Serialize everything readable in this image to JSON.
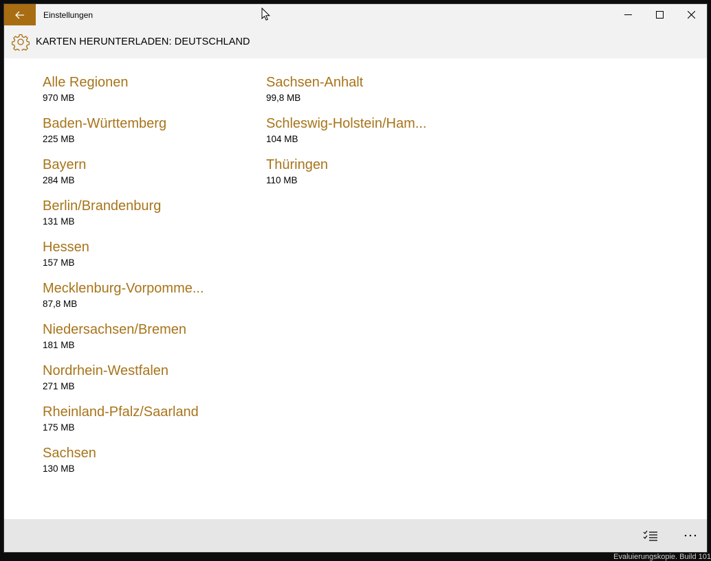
{
  "window": {
    "title": "Einstellungen"
  },
  "header": {
    "title": "KARTEN HERUNTERLADEN: DEUTSCHLAND"
  },
  "regions_col1": [
    {
      "name": "Alle Regionen",
      "size": "970 MB"
    },
    {
      "name": "Baden-Württemberg",
      "size": "225 MB"
    },
    {
      "name": "Bayern",
      "size": "284 MB"
    },
    {
      "name": "Berlin/Brandenburg",
      "size": "131 MB"
    },
    {
      "name": "Hessen",
      "size": "157 MB"
    },
    {
      "name": "Mecklenburg-Vorpomme...",
      "size": "87,8 MB"
    },
    {
      "name": "Niedersachsen/Bremen",
      "size": "181 MB"
    },
    {
      "name": "Nordrhein-Westfalen",
      "size": "271 MB"
    },
    {
      "name": "Rheinland-Pfalz/Saarland",
      "size": "175 MB"
    },
    {
      "name": "Sachsen",
      "size": "130 MB"
    }
  ],
  "regions_col2": [
    {
      "name": "Sachsen-Anhalt",
      "size": "99,8 MB"
    },
    {
      "name": "Schleswig-Holstein/Ham...",
      "size": "104 MB"
    },
    {
      "name": "Thüringen",
      "size": "110 MB"
    }
  ],
  "icons": {
    "back": "back-arrow-icon",
    "minimize": "minimize-icon",
    "maximize": "maximize-icon",
    "close": "close-icon",
    "settings": "gear-icon",
    "select": "select-list-icon",
    "more": "more-icon"
  },
  "colors": {
    "accent": "#a86d12",
    "region_text": "#a8741a",
    "chrome_bg": "#f2f2f2",
    "appbar_bg": "#e6e6e6"
  },
  "watermark": "Evaluierungskopie. Build 101"
}
